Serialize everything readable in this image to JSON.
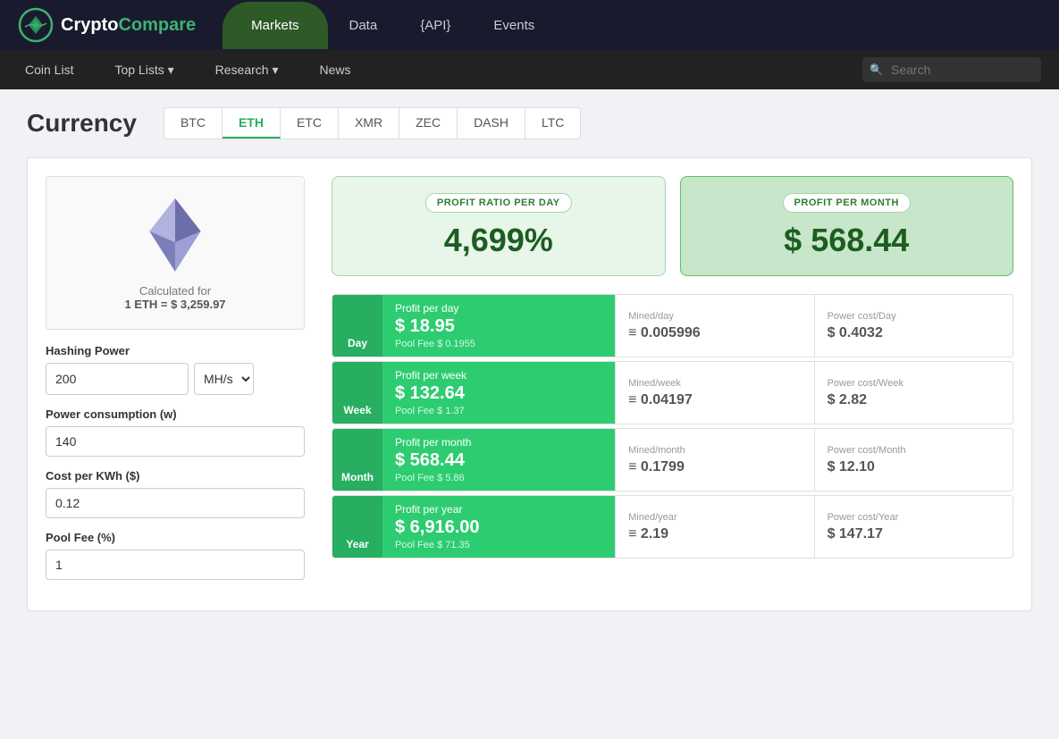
{
  "brand": {
    "name_crypto": "Crypto",
    "name_compare": "Compare"
  },
  "top_nav": {
    "links": [
      {
        "label": "Markets",
        "active": true
      },
      {
        "label": "Data",
        "active": false
      },
      {
        "label": "{API}",
        "active": false
      },
      {
        "label": "Events",
        "active": false
      }
    ]
  },
  "secondary_nav": {
    "links": [
      {
        "label": "Coin List"
      },
      {
        "label": "Top Lists ▾"
      },
      {
        "label": "Research ▾"
      },
      {
        "label": "News"
      }
    ],
    "search_placeholder": "Search"
  },
  "currency": {
    "title": "Currency",
    "tabs": [
      "BTC",
      "ETH",
      "ETC",
      "XMR",
      "ZEC",
      "DASH",
      "LTC"
    ],
    "active_tab": "ETH"
  },
  "eth_info": {
    "calculated_label": "Calculated for",
    "calculated_value": "1 ETH = $ 3,259.97"
  },
  "form": {
    "hashing_power_label": "Hashing Power",
    "hashing_power_value": "200",
    "hashing_power_unit": "MH/s",
    "power_consumption_label": "Power consumption (w)",
    "power_consumption_value": "140",
    "cost_per_kwh_label": "Cost per KWh ($)",
    "cost_per_kwh_value": "0.12",
    "pool_fee_label": "Pool Fee (%)",
    "pool_fee_value": "1"
  },
  "summary": {
    "ratio_label": "PROFIT RATIO PER DAY",
    "ratio_value": "4,699%",
    "profit_label": "PROFIT PER MONTH",
    "profit_value": "$ 568.44"
  },
  "rows": [
    {
      "period": "Day",
      "profit_label": "Profit per day",
      "profit_value": "$ 18.95",
      "pool_fee": "Pool Fee $ 0.1955",
      "mined_label": "Mined/day",
      "mined_value": "≡ 0.005996",
      "power_label": "Power cost/Day",
      "power_value": "$ 0.4032"
    },
    {
      "period": "Week",
      "profit_label": "Profit per week",
      "profit_value": "$ 132.64",
      "pool_fee": "Pool Fee $ 1.37",
      "mined_label": "Mined/week",
      "mined_value": "≡ 0.04197",
      "power_label": "Power cost/Week",
      "power_value": "$ 2.82"
    },
    {
      "period": "Month",
      "profit_label": "Profit per month",
      "profit_value": "$ 568.44",
      "pool_fee": "Pool Fee $ 5.86",
      "mined_label": "Mined/month",
      "mined_value": "≡ 0.1799",
      "power_label": "Power cost/Month",
      "power_value": "$ 12.10"
    },
    {
      "period": "Year",
      "profit_label": "Profit per year",
      "profit_value": "$ 6,916.00",
      "pool_fee": "Pool Fee $ 71.35",
      "mined_label": "Mined/year",
      "mined_value": "≡ 2.19",
      "power_label": "Power cost/Year",
      "power_value": "$ 147.17"
    }
  ]
}
